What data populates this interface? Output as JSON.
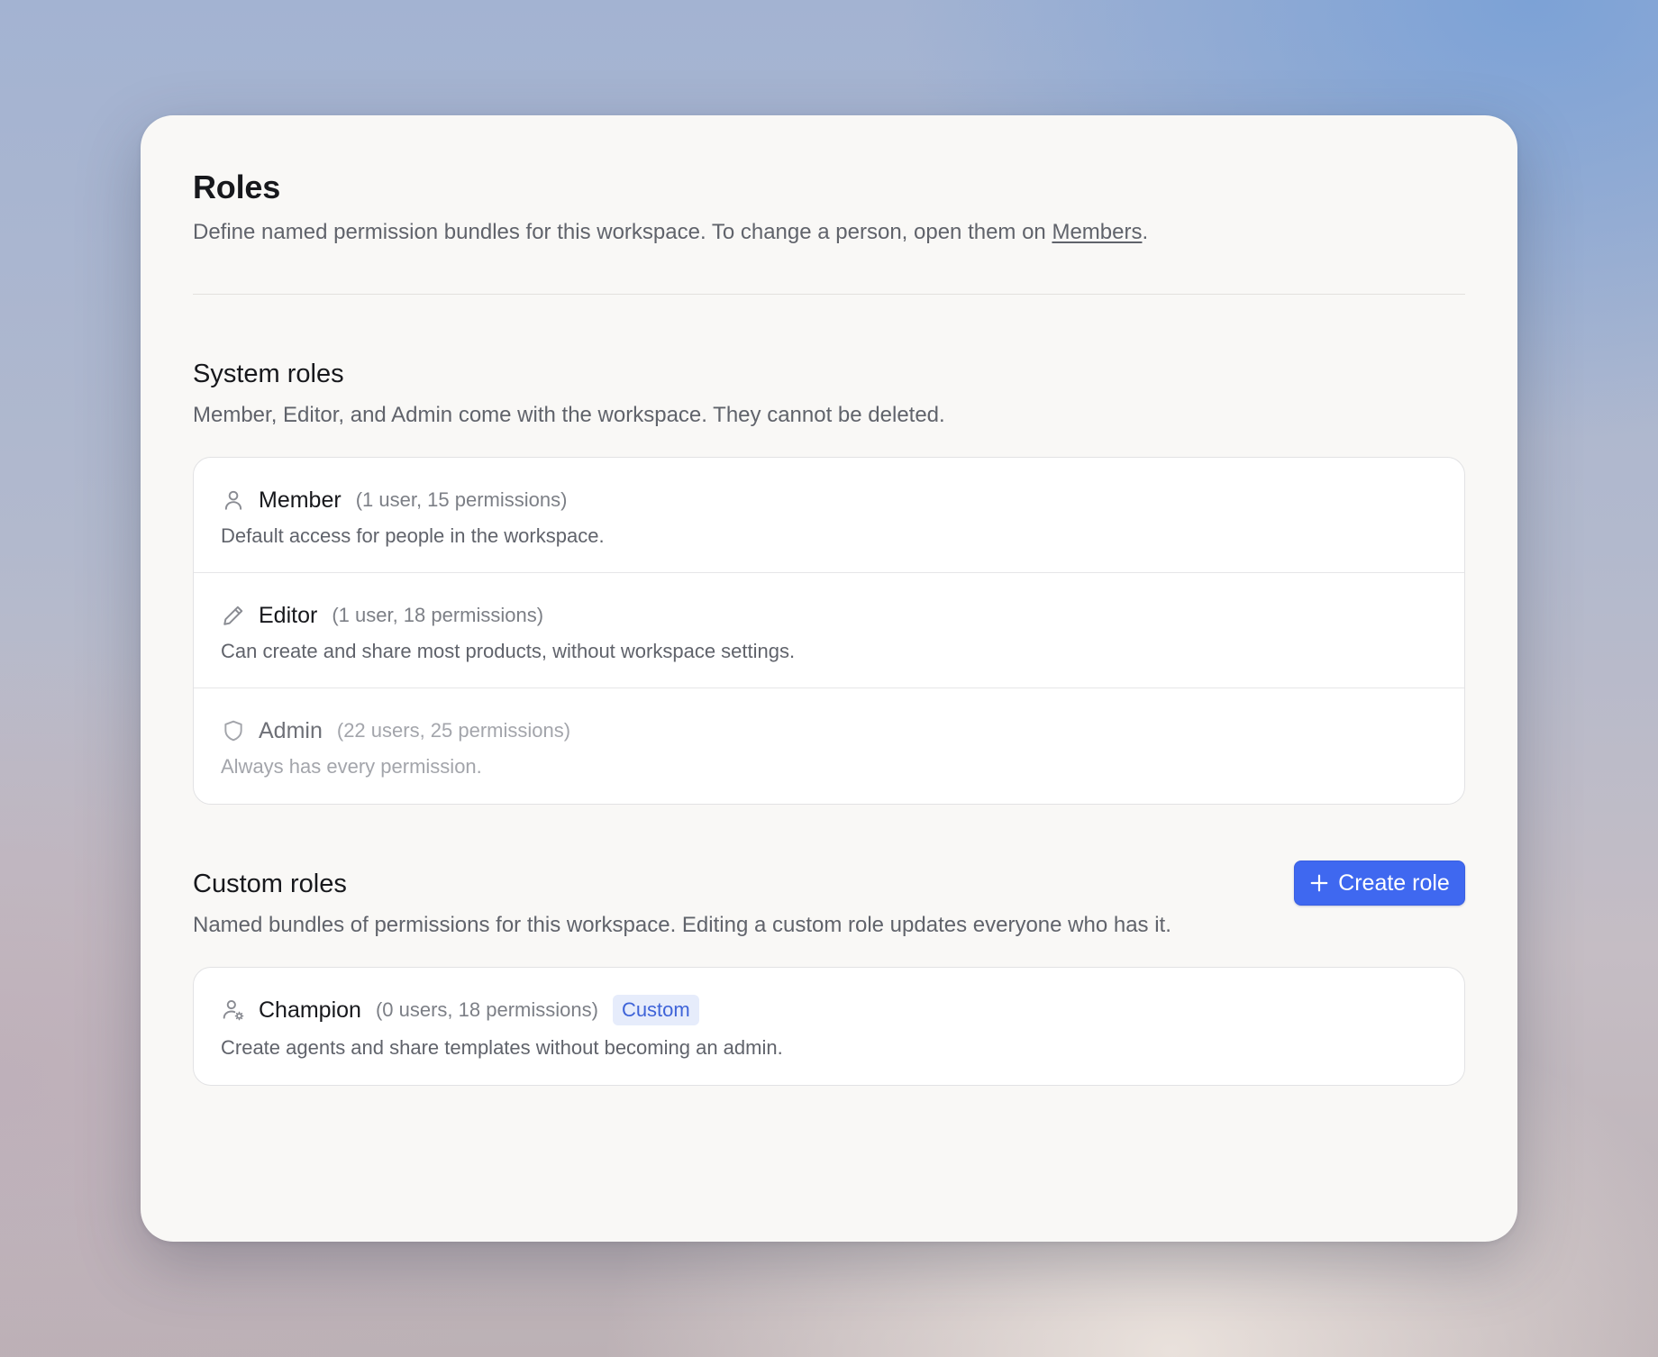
{
  "header": {
    "title": "Roles",
    "subtitle_prefix": "Define named permission bundles for this workspace. To change a person, open them on ",
    "subtitle_link": "Members",
    "subtitle_suffix": "."
  },
  "system_roles": {
    "title": "System roles",
    "subtitle": "Member, Editor, and Admin come with the workspace. They cannot be deleted.",
    "roles": [
      {
        "icon": "user-icon",
        "name": "Member",
        "meta": "(1 user, 15 permissions)",
        "description": "Default access for people in the workspace."
      },
      {
        "icon": "pencil-icon",
        "name": "Editor",
        "meta": "(1 user, 18 permissions)",
        "description": "Can create and share most products, without workspace settings."
      },
      {
        "icon": "shield-icon",
        "name": "Admin",
        "meta": "(22 users, 25 permissions)",
        "description": "Always has every permission."
      }
    ]
  },
  "custom_roles": {
    "title": "Custom roles",
    "subtitle": "Named bundles of permissions for this workspace. Editing a custom role updates everyone who has it.",
    "create_button_label": "Create role",
    "roles": [
      {
        "icon": "user-gear-icon",
        "name": "Champion",
        "meta": "(0 users, 18 permissions)",
        "badge": "Custom",
        "description": "Create agents and share templates without becoming an admin."
      }
    ]
  },
  "colors": {
    "accent": "#3f68f0",
    "badge_bg": "#e6ecfb",
    "badge_text": "#3e63d8"
  }
}
